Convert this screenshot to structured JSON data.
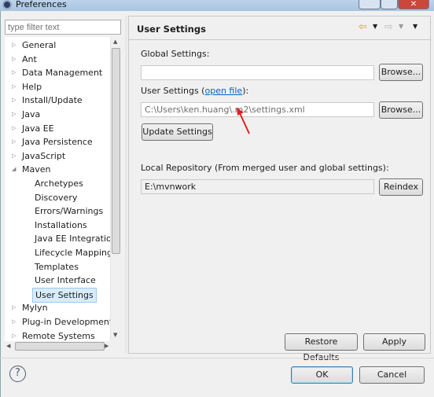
{
  "window": {
    "title": "Preferences"
  },
  "filter": {
    "placeholder": "type filter text"
  },
  "tree": [
    {
      "label": "General",
      "level": 0,
      "state": "collapsed"
    },
    {
      "label": "Ant",
      "level": 0,
      "state": "collapsed"
    },
    {
      "label": "Data Management",
      "level": 0,
      "state": "collapsed"
    },
    {
      "label": "Help",
      "level": 0,
      "state": "collapsed"
    },
    {
      "label": "Install/Update",
      "level": 0,
      "state": "collapsed"
    },
    {
      "label": "Java",
      "level": 0,
      "state": "collapsed"
    },
    {
      "label": "Java EE",
      "level": 0,
      "state": "collapsed"
    },
    {
      "label": "Java Persistence",
      "level": 0,
      "state": "collapsed"
    },
    {
      "label": "JavaScript",
      "level": 0,
      "state": "collapsed"
    },
    {
      "label": "Maven",
      "level": 0,
      "state": "expanded"
    },
    {
      "label": "Archetypes",
      "level": 1
    },
    {
      "label": "Discovery",
      "level": 1
    },
    {
      "label": "Errors/Warnings",
      "level": 1
    },
    {
      "label": "Installations",
      "level": 1
    },
    {
      "label": "Java EE Integration",
      "level": 1
    },
    {
      "label": "Lifecycle Mappings",
      "level": 1
    },
    {
      "label": "Templates",
      "level": 1
    },
    {
      "label": "User Interface",
      "level": 1
    },
    {
      "label": "User Settings",
      "level": 1,
      "selected": true
    },
    {
      "label": "Mylyn",
      "level": 0,
      "state": "collapsed"
    },
    {
      "label": "Plug-in Development",
      "level": 0,
      "state": "collapsed"
    },
    {
      "label": "Remote Systems",
      "level": 0,
      "state": "collapsed"
    }
  ],
  "page": {
    "title": "User Settings",
    "global_label": "Global Settings:",
    "global_value": "",
    "browse": "Browse...",
    "user_label_pre": "User Settings (",
    "user_link": "open file",
    "user_label_post": "):",
    "user_value": "C:\\Users\\ken.huang\\.m2\\settings.xml",
    "update": "Update Settings",
    "local_label": "Local Repository (From merged user and global settings):",
    "local_value": "E:\\mvnwork",
    "reindex": "Reindex",
    "restore": "Restore Defaults",
    "apply": "Apply"
  },
  "footer": {
    "help": "?",
    "ok": "OK",
    "cancel": "Cancel"
  },
  "colors": {
    "arrow": "#e02020",
    "selection": "#d9ecfb"
  }
}
